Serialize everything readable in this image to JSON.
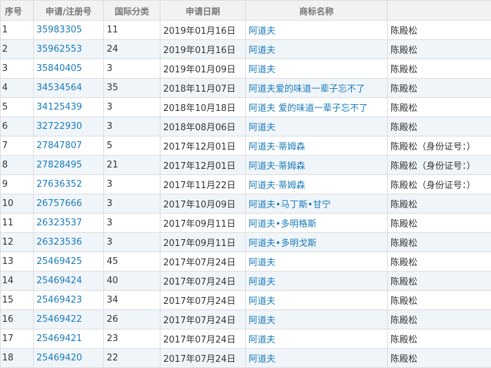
{
  "table": {
    "headers": [
      "序号",
      "申请/注册号",
      "国际分类",
      "申请日期",
      "商标名称",
      ""
    ],
    "rows": [
      {
        "seq": "1",
        "reg": "35983305",
        "cls": "11",
        "date": "2019年01月16日",
        "name": "阿道夫",
        "applicant": "陈殿松"
      },
      {
        "seq": "2",
        "reg": "35962553",
        "cls": "24",
        "date": "2019年01月16日",
        "name": "阿道夫",
        "applicant": "陈殿松"
      },
      {
        "seq": "3",
        "reg": "35840405",
        "cls": "3",
        "date": "2019年01月09日",
        "name": "阿道夫",
        "applicant": "陈殿松"
      },
      {
        "seq": "4",
        "reg": "34534564",
        "cls": "35",
        "date": "2018年11月07日",
        "name": "阿道夫爱的味道一辈子忘不了",
        "applicant": "陈殿松"
      },
      {
        "seq": "5",
        "reg": "34125439",
        "cls": "3",
        "date": "2018年10月18日",
        "name": "阿道夫 爱的味道一辈子忘不了",
        "applicant": "陈殿松"
      },
      {
        "seq": "6",
        "reg": "32722930",
        "cls": "3",
        "date": "2018年08月06日",
        "name": "阿道夫",
        "applicant": "陈殿松"
      },
      {
        "seq": "7",
        "reg": "27847807",
        "cls": "5",
        "date": "2017年12月01日",
        "name": "阿道夫·蒂姆森",
        "applicant": "陈殿松（身份证号：）"
      },
      {
        "seq": "8",
        "reg": "27828495",
        "cls": "21",
        "date": "2017年12月01日",
        "name": "阿道夫·蒂姆森",
        "applicant": "陈殿松（身份证号：）"
      },
      {
        "seq": "9",
        "reg": "27636352",
        "cls": "3",
        "date": "2017年11月22日",
        "name": "阿道夫·蒂姆森",
        "applicant": "陈殿松（身份证号：）"
      },
      {
        "seq": "10",
        "reg": "26757666",
        "cls": "3",
        "date": "2017年10月09日",
        "name": "阿道夫•马丁斯•甘宁",
        "applicant": "陈殿松"
      },
      {
        "seq": "11",
        "reg": "26323537",
        "cls": "3",
        "date": "2017年09月11日",
        "name": "阿道夫•多明格斯",
        "applicant": "陈殿松"
      },
      {
        "seq": "12",
        "reg": "26323536",
        "cls": "3",
        "date": "2017年09月11日",
        "name": "阿道夫•多明戈斯",
        "applicant": "陈殿松"
      },
      {
        "seq": "13",
        "reg": "25469425",
        "cls": "45",
        "date": "2017年07月24日",
        "name": "阿道夫",
        "applicant": "陈殿松"
      },
      {
        "seq": "14",
        "reg": "25469424",
        "cls": "40",
        "date": "2017年07月24日",
        "name": "阿道夫",
        "applicant": "陈殿松"
      },
      {
        "seq": "15",
        "reg": "25469423",
        "cls": "34",
        "date": "2017年07月24日",
        "name": "阿道夫",
        "applicant": "陈殿松"
      },
      {
        "seq": "16",
        "reg": "25469422",
        "cls": "26",
        "date": "2017年07月24日",
        "name": "阿道夫",
        "applicant": "陈殿松"
      },
      {
        "seq": "17",
        "reg": "25469421",
        "cls": "23",
        "date": "2017年07月24日",
        "name": "阿道夫",
        "applicant": "陈殿松"
      },
      {
        "seq": "18",
        "reg": "25469420",
        "cls": "22",
        "date": "2017年07月24日",
        "name": "阿道夫",
        "applicant": "陈殿松"
      }
    ]
  },
  "colors": {
    "link": "#1a7bb9",
    "header_bg": "#f2f2f2",
    "stripe": "#f0f5fa",
    "border": "#dcdcdc"
  }
}
